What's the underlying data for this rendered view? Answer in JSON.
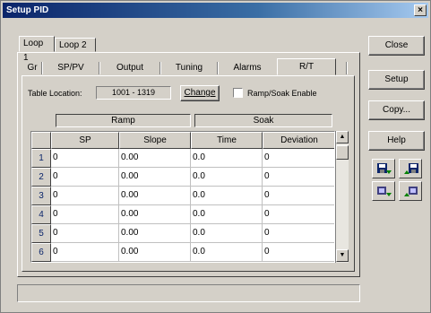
{
  "window": {
    "title": "Setup PID",
    "close_glyph": "×"
  },
  "outer_tabs": [
    {
      "label": "Loop 1"
    },
    {
      "label": "Loop 2"
    }
  ],
  "inner_tabs": [
    "Gr",
    "SP/PV",
    "Output",
    "Tuning",
    "Alarms",
    "R/T"
  ],
  "table_location": {
    "label": "Table Location:",
    "value": "1001 - 1319",
    "change_label": "Change"
  },
  "ramp_soak": {
    "label": "Ramp/Soak Enable",
    "checked": false
  },
  "groups": {
    "ramp": "Ramp",
    "soak": "Soak"
  },
  "grid": {
    "columns": [
      "SP",
      "Slope",
      "Time",
      "Deviation"
    ],
    "rows": [
      {
        "num": "1",
        "sp": "0",
        "slope": "0.00",
        "time": "0.0",
        "deviation": "0"
      },
      {
        "num": "2",
        "sp": "0",
        "slope": "0.00",
        "time": "0.0",
        "deviation": "0"
      },
      {
        "num": "3",
        "sp": "0",
        "slope": "0.00",
        "time": "0.0",
        "deviation": "0"
      },
      {
        "num": "4",
        "sp": "0",
        "slope": "0.00",
        "time": "0.0",
        "deviation": "0"
      },
      {
        "num": "5",
        "sp": "0",
        "slope": "0.00",
        "time": "0.0",
        "deviation": "0"
      },
      {
        "num": "6",
        "sp": "0",
        "slope": "0.00",
        "time": "0.0",
        "deviation": "0"
      }
    ]
  },
  "buttons": {
    "close": "Close",
    "setup": "Setup",
    "copy": "Copy...",
    "help": "Help"
  },
  "icons": [
    "save-to-disk-icon",
    "load-from-disk-icon",
    "copy-to-plc-icon",
    "copy-from-plc-icon"
  ],
  "colors": {
    "title_start": "#0a246a",
    "title_end": "#a6caf0",
    "face": "#d4d0c8",
    "row_header_text": "#0a246a"
  }
}
